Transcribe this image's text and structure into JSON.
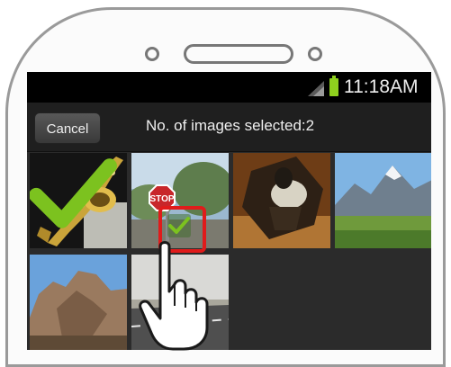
{
  "status_bar": {
    "time": "11:18AM"
  },
  "action_bar": {
    "cancel_label": "Cancel",
    "title": "No. of images selected:2"
  },
  "thumbnails": [
    {
      "name": "saxophone",
      "selected": true
    },
    {
      "name": "stop-sign",
      "selected": true,
      "sign_text": "STOP"
    },
    {
      "name": "bronze-figure",
      "selected": false
    },
    {
      "name": "mountain-lake",
      "selected": false
    },
    {
      "name": "rock-formation",
      "selected": false
    },
    {
      "name": "road",
      "selected": false
    }
  ],
  "colors": {
    "check": "#7cc21f",
    "highlight": "#e01b1b",
    "battery": "#8fd11e"
  }
}
